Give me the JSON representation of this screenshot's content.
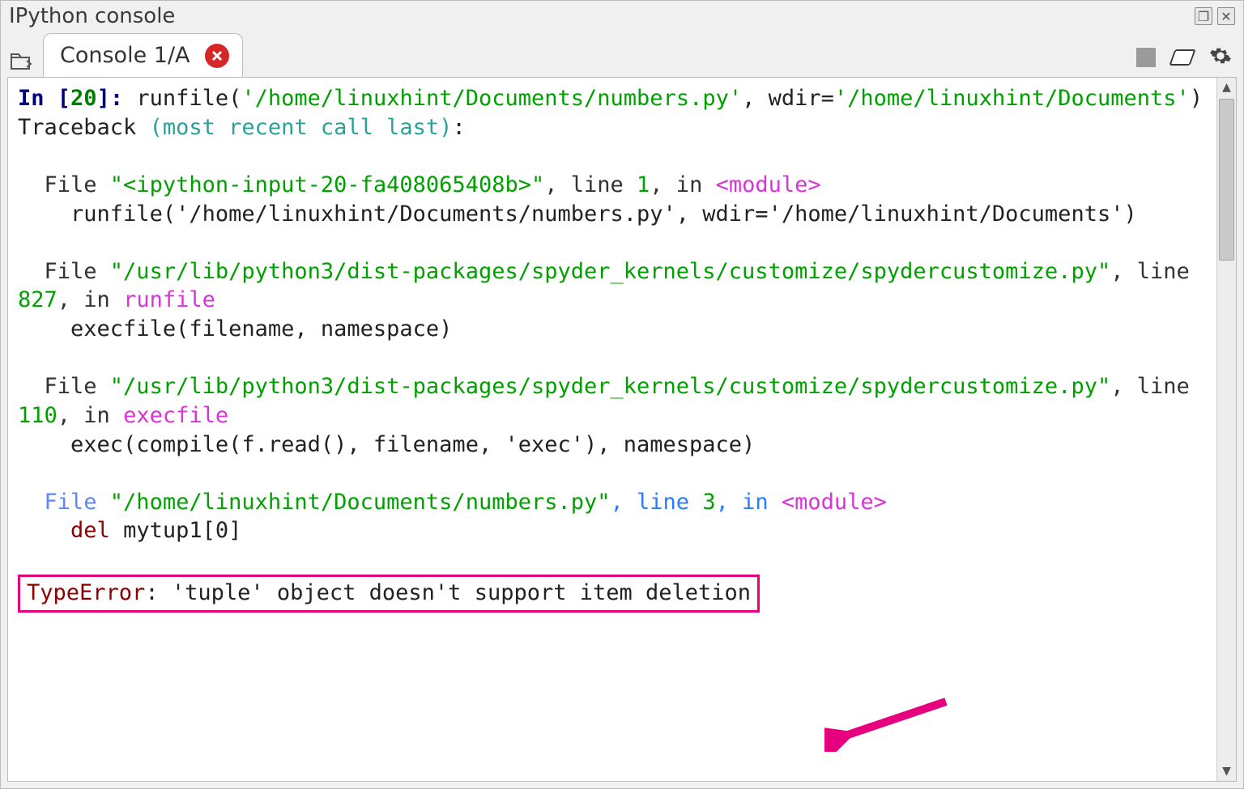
{
  "title": "IPython console",
  "tab": {
    "label": "Console 1/A"
  },
  "prompt": {
    "in_label": "In ",
    "bracket_open": "[",
    "count": "20",
    "bracket_close": "]: "
  },
  "run": {
    "fn": "runfile(",
    "path": "'/home/linuxhint/Documents/numbers.py'",
    "sep": ", wdir=",
    "wdir": "'/home/linuxhint/Documents'",
    "close": ")"
  },
  "tb": {
    "head": "Traceback ",
    "tail": "(most recent call last)",
    "colon": ":"
  },
  "frames": [
    {
      "indent": "  ",
      "file_kw": "File ",
      "path": "\"<ipython-input-20-fa408065408b>\"",
      "line_lbl": ", line ",
      "line_no": "1",
      "in": ", in ",
      "name": "<module>",
      "code_indent": "    ",
      "code_plain": "runfile('/home/linuxhint/Documents/numbers.py', wdir='/home/linuxhint/Documents')"
    },
    {
      "indent": "  ",
      "file_kw": "File ",
      "path": "\"/usr/lib/python3/dist-packages/spyder_kernels/customize/spydercustomize.py\"",
      "line_lbl": ", line ",
      "line_no": "827",
      "in": ", in ",
      "name": "runfile",
      "code_indent": "    ",
      "code_plain": "execfile(filename, namespace)"
    },
    {
      "indent": "  ",
      "file_kw": "File ",
      "path": "\"/usr/lib/python3/dist-packages/spyder_kernels/customize/spydercustomize.py\"",
      "line_lbl": ", line ",
      "line_no": "110",
      "in": ", in ",
      "name": "execfile",
      "code_indent": "    ",
      "code_plain": "exec(compile(f.read(), filename, 'exec'), namespace)"
    }
  ],
  "frame4": {
    "indent": "  ",
    "file_kw": "File ",
    "path": "\"/home/linuxhint/Documents/numbers.py\"",
    "line_lbl": ", line ",
    "line_no": "3",
    "in": ", in ",
    "name": "<module>",
    "code_indent": "    ",
    "del_kw": "del",
    "code": " mytup1[0]"
  },
  "error": {
    "type": "TypeError",
    "msg": ": 'tuple' object doesn't support item deletion"
  }
}
